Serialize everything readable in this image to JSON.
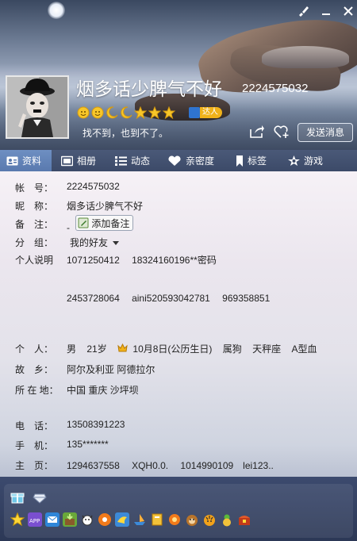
{
  "window": {
    "controls": {
      "skin_icon": "brush-icon",
      "minimize": "–",
      "close": "✕"
    }
  },
  "profile": {
    "nickname": "烟多话少脾气不好",
    "qq_number": "2224575032",
    "signature": "找不到，也到不了。",
    "level_icons": [
      "sun",
      "sun",
      "moon",
      "moon",
      "star",
      "star",
      "star"
    ],
    "badge": "达人",
    "send_message": "发送消息"
  },
  "tabs": [
    {
      "label": "资料",
      "icon": "profile-card-icon",
      "active": true
    },
    {
      "label": "相册",
      "icon": "photo-icon",
      "active": false
    },
    {
      "label": "动态",
      "icon": "list-icon",
      "active": false
    },
    {
      "label": "亲密度",
      "icon": "heart-icon",
      "active": false
    },
    {
      "label": "标签",
      "icon": "bookmark-icon",
      "active": false
    },
    {
      "label": "游戏",
      "icon": "game-icon",
      "active": false
    }
  ],
  "info": {
    "account_label": "帐　号：",
    "account": "2224575032",
    "nickname_label": "昵　称：",
    "nickname": "烟多话少脾气不好",
    "note_label": "备　注：",
    "note_value": "-",
    "add_note": "添加备注",
    "group_label": "分　组：",
    "group": "我的好友",
    "bio_label": "个人说明",
    "bio_line1": "1071250412　  18324160196**密码",
    "bio_line2": "2453728064　   aini520593042781　 969358851",
    "person_label": "个　人：",
    "gender": "男",
    "age": "21岁",
    "birthday": "10月8日(公历生日)",
    "zodiac": "属狗",
    "constellation": "天秤座",
    "blood": "A型血",
    "hometown_label": "故　乡：",
    "hometown": "阿尔及利亚 阿德拉尔",
    "location_label": "所 在 地：",
    "location": "中国 重庆 沙坪坝",
    "phone_label": "电　话：",
    "phone": "13508391223",
    "mobile_label": "手　机：",
    "mobile": "135*******",
    "homepage_label": "主　页：",
    "homepage": "1294637558　 XQH0.0.　   1014990109　lei123.."
  },
  "bottom_apps": [
    "gift-icon",
    "diamond-icon",
    "star-icon",
    "app-store-icon",
    "mail-icon",
    "farm-icon",
    "cow-icon",
    "music-icon",
    "bird-icon",
    "boat-icon",
    "book-icon",
    "flower-icon",
    "monkey-icon",
    "tiger-icon",
    "gourd-icon",
    "treasure-icon"
  ]
}
